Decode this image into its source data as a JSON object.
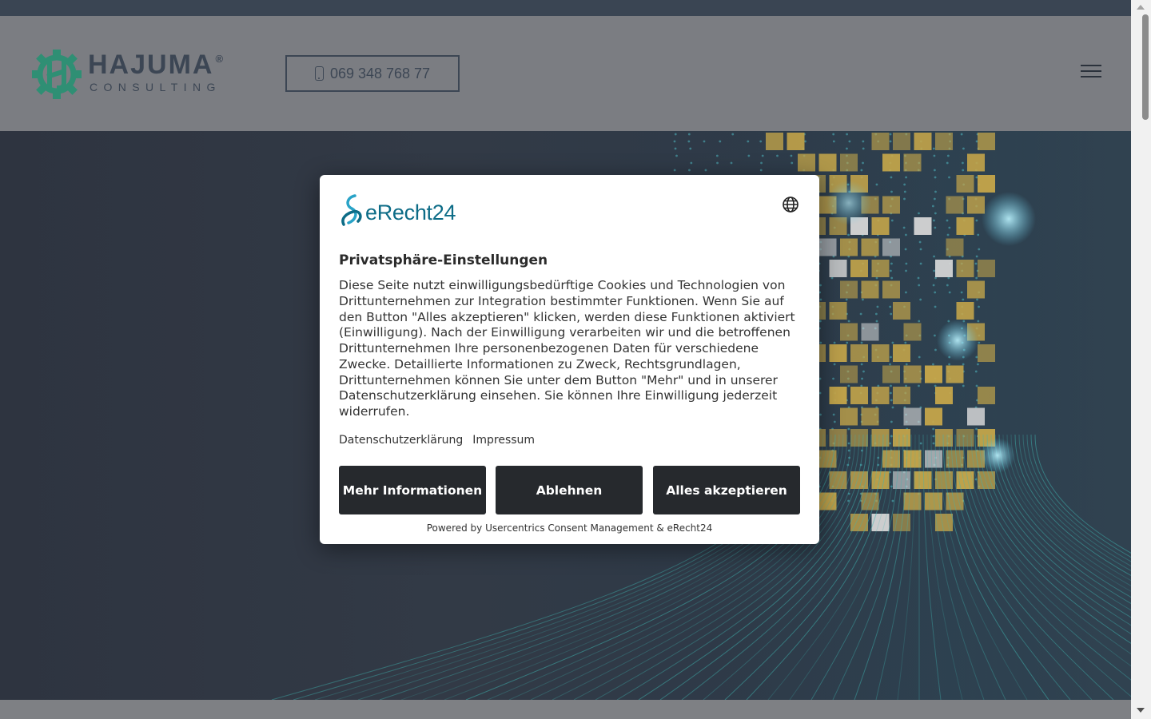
{
  "header": {
    "logo_name": "HAJUMA",
    "logo_registered": "®",
    "logo_sub": "CONSULTING",
    "phone": "069 348 768 77",
    "menu_icon": "hamburger-icon"
  },
  "consent": {
    "brand": "eRecht24",
    "language_icon": "globe-icon",
    "title": "Privatsphäre-Einstellungen",
    "body": "Diese Seite nutzt einwilligungsbedürftige Cookies und Technologien von Drittunternehmen zur Integration bestimmter Funktionen. Wenn Sie auf den Button \"Alles akzeptieren\" klicken, werden diese Funktionen aktiviert (Einwilligung). Nach der Einwilligung verarbeiten wir und die betroffenen Drittunternehmen Ihre personenbezogenen Daten für verschiedene Zwecke. Detaillierte Informationen zu Zweck, Rechtsgrundlagen, Drittunternehmen können Sie unter dem Button \"Mehr\" und in unserer Datenschutzerklärung einsehen. Sie können Ihre Einwilligung jederzeit widerrufen.",
    "links": {
      "privacy": "Datenschutzerklärung",
      "imprint": "Impressum"
    },
    "buttons": {
      "more": "Mehr Informationen",
      "deny": "Ablehnen",
      "accept": "Alles akzeptieren"
    },
    "powered_by": "Powered by Usercentrics Consent Management & eRecht24"
  },
  "colors": {
    "brand_green": "#2f8f74",
    "text_dark": "#3c4654",
    "button_dark": "#26292d",
    "erecht_blue": "#0d6c87",
    "erecht_cyan": "#29a3c7",
    "hero_gold": "#c8a84a",
    "hero_teal": "#3fb4b0"
  }
}
